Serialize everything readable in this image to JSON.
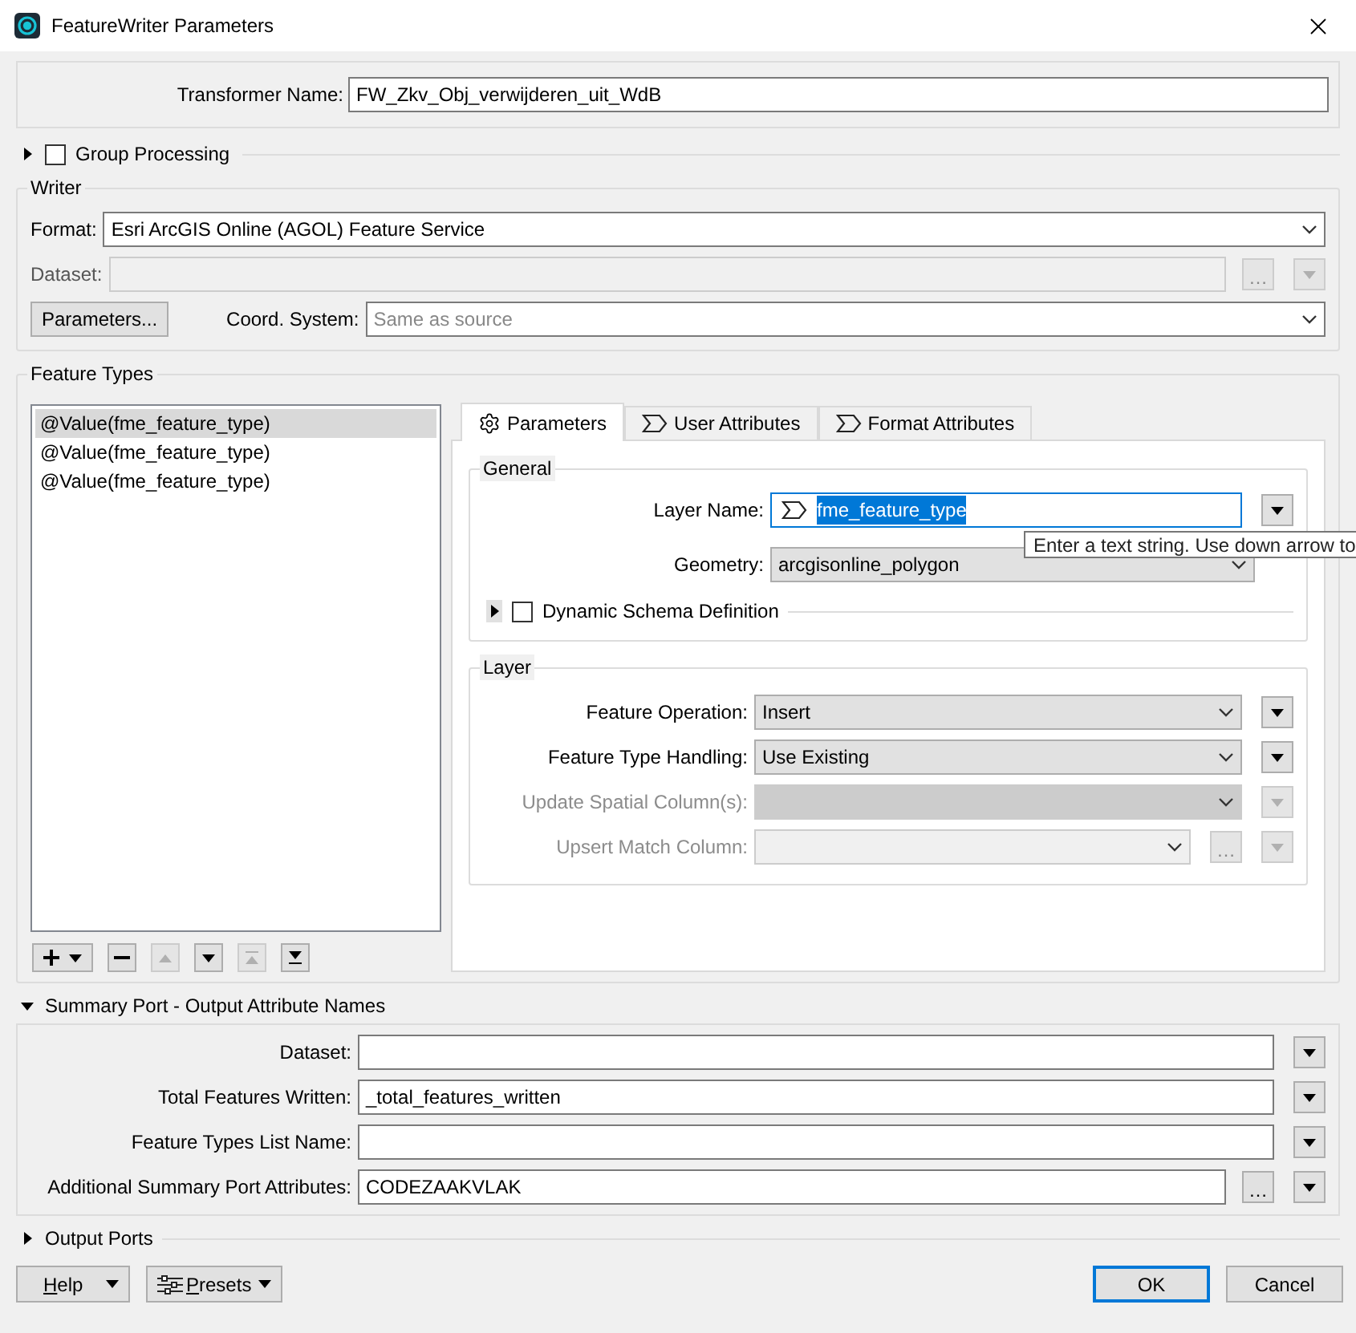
{
  "window": {
    "title": "FeatureWriter Parameters"
  },
  "transformer_name": {
    "label": "Transformer Name:",
    "value": "FW_Zkv_Obj_verwijderen_uit_WdB"
  },
  "group_processing": {
    "label": "Group Processing",
    "expanded": false,
    "checked": false
  },
  "writer": {
    "title": "Writer",
    "format": {
      "label": "Format:",
      "value": "Esri ArcGIS Online (AGOL) Feature Service"
    },
    "dataset": {
      "label": "Dataset:",
      "disabled": true,
      "browse": "…"
    },
    "parameters_button": "Parameters...",
    "coord_system": {
      "label": "Coord. System:",
      "placeholder": "Same as source"
    }
  },
  "feature_types": {
    "title": "Feature Types",
    "items": [
      {
        "label": "@Value(fme_feature_type)",
        "selected": true
      },
      {
        "label": "@Value(fme_feature_type)",
        "selected": false
      },
      {
        "label": "@Value(fme_feature_type)",
        "selected": false
      }
    ],
    "list_buttons": [
      {
        "kind": "add",
        "disabled": false
      },
      {
        "kind": "remove",
        "disabled": false
      },
      {
        "kind": "up",
        "disabled": true
      },
      {
        "kind": "down",
        "disabled": false
      },
      {
        "kind": "top",
        "disabled": true
      },
      {
        "kind": "bottom",
        "disabled": false
      }
    ],
    "tabs": [
      {
        "label": "Parameters",
        "kind": "gear",
        "selected": true
      },
      {
        "label": "User Attributes",
        "kind": "attr",
        "selected": false
      },
      {
        "label": "Format Attributes",
        "kind": "attr",
        "selected": false
      }
    ],
    "general": {
      "title": "General",
      "layer_name": {
        "label": "Layer Name:",
        "value": "fme_feature_type",
        "selected": true
      },
      "geometry": {
        "label": "Geometry:",
        "value": "arcgisonline_polygon"
      },
      "dynamic_schema": {
        "label": "Dynamic Schema Definition",
        "checked": false,
        "expanded": false
      }
    },
    "layer": {
      "title": "Layer",
      "rows": [
        {
          "label": "Feature Operation:",
          "value": "Insert",
          "kind": "select",
          "disabled": false
        },
        {
          "label": "Feature Type Handling:",
          "value": "Use Existing",
          "kind": "select",
          "disabled": false
        },
        {
          "label": "Update Spatial Column(s):",
          "kind": "select",
          "disabled": true
        },
        {
          "label": "Upsert Match Column:",
          "kind": "combo",
          "disabled": true,
          "browse": "…"
        }
      ]
    }
  },
  "tooltip": "Enter a text string. Use down arrow to",
  "summary_port": {
    "title": "Summary Port - Output Attribute Names",
    "expanded": true,
    "rows": [
      {
        "label": "Dataset:",
        "kind": "text"
      },
      {
        "label": "Total Features Written:",
        "value": "_total_features_written",
        "kind": "text"
      },
      {
        "label": "Feature Types List Name:",
        "kind": "text"
      },
      {
        "label": "Additional Summary Port Attributes:",
        "value": "CODEZAAKVLAK",
        "kind": "list",
        "browse": "…"
      }
    ]
  },
  "output_ports": {
    "title": "Output Ports",
    "expanded": false
  },
  "buttons": {
    "help": "Help",
    "presets": "Presets",
    "ok": "OK",
    "cancel": "Cancel"
  }
}
